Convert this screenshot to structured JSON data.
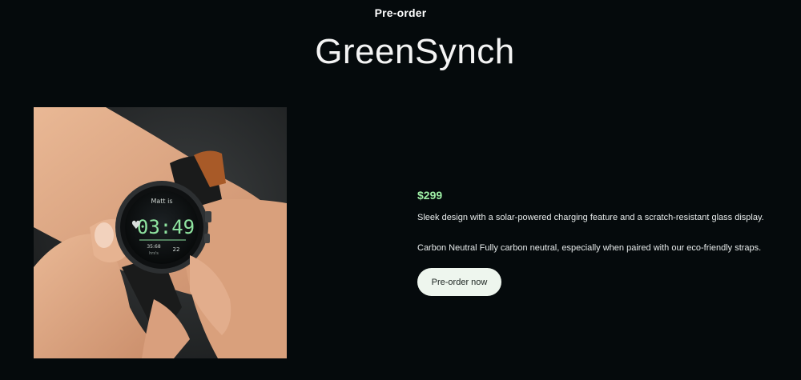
{
  "header": {
    "eyebrow": "Pre-order",
    "title": "GreenSynch"
  },
  "product": {
    "image_alt": "Smartwatch on wrist",
    "watch_face": {
      "brand": "Matt is",
      "time": "03:49",
      "stat_left": "35:68",
      "stat_left_sub": "hrs's",
      "stat_right": "22"
    },
    "price": "$299",
    "description": "Sleek design with a solar-powered charging feature and a scratch-resistant glass display.",
    "feature": "Carbon Neutral Fully carbon neutral, especially when paired with our eco-friendly straps.",
    "cta_label": "Pre-order now"
  },
  "colors": {
    "background": "#050a0c",
    "price": "#9ff0a6",
    "button_bg": "#eef6ee",
    "watch_digits": "#8fe4a0"
  }
}
